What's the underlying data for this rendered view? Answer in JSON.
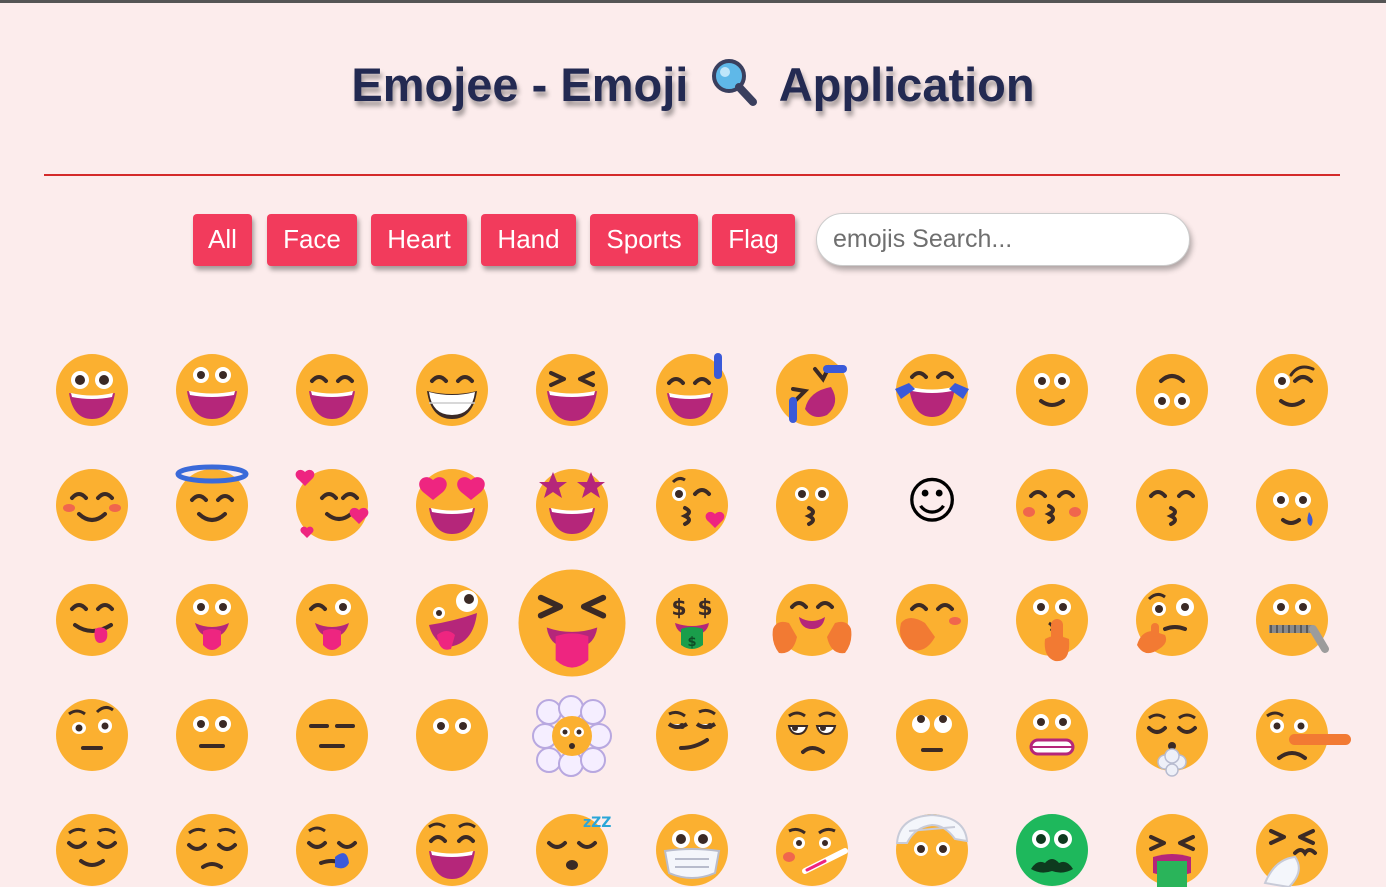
{
  "title_left": "Emojee - Emoji",
  "title_right": "Application",
  "filters": [
    "All",
    "Face",
    "Heart",
    "Hand",
    "Sports",
    "Flag"
  ],
  "search": {
    "placeholder": "emojis Search..."
  },
  "colors": {
    "background": "#fcecec",
    "title": "#232a52",
    "divider": "#d42a2a",
    "button": "#f23b5c",
    "emoji_face": "#fbb030"
  },
  "emojis": [
    [
      "grinning-face",
      "grinning-face-with-big-eyes",
      "grinning-face-with-smiling-eyes",
      "beaming-face",
      "grinning-squinting-face",
      "grinning-face-with-sweat",
      "rolling-on-the-floor-laughing",
      "face-with-tears-of-joy",
      "slightly-smiling-face",
      "upside-down-face",
      "winking-face"
    ],
    [
      "smiling-face-with-smiling-eyes",
      "smiling-face-with-halo",
      "smiling-face-with-hearts",
      "smiling-face-with-heart-eyes",
      "star-struck",
      "face-blowing-a-kiss",
      "kissing-face",
      "smiling-face",
      "kissing-face-with-closed-eyes",
      "kissing-face-with-smiling-eyes",
      "smiling-face-with-tear"
    ],
    [
      "face-savoring-food",
      "face-with-tongue",
      "winking-face-with-tongue",
      "zany-face",
      "squinting-face-with-tongue",
      "money-mouth-face",
      "hugging-face",
      "face-with-hand-over-mouth",
      "shushing-face",
      "thinking-face",
      "zipper-mouth-face"
    ],
    [
      "face-with-raised-eyebrow",
      "neutral-face",
      "expressionless-face",
      "face-without-mouth",
      "face-in-clouds",
      "smirking-face",
      "unamused-face",
      "face-with-rolling-eyes",
      "grimacing-face",
      "face-exhaling",
      "lying-face"
    ],
    [
      "relieved-face",
      "pensive-face",
      "sleepy-face",
      "drooling-face",
      "sleeping-face",
      "face-with-medical-mask",
      "face-with-thermometer",
      "face-with-head-bandage",
      "nauseated-face",
      "face-vomiting",
      "sneezing-face"
    ]
  ]
}
